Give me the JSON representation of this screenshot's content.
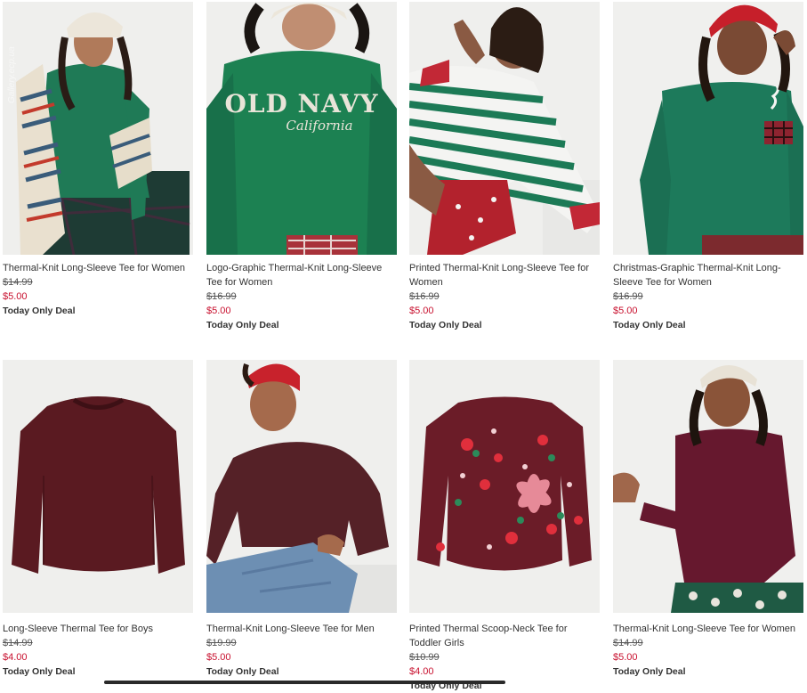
{
  "colors": {
    "sale": "#c8102e",
    "text": "#333333",
    "strike": "#555555"
  },
  "watermark": "Gallery.ecp.ua",
  "products": [
    {
      "image_icon": "woman-green-tee-fairisle-scarf-icon",
      "title": "Thermal-Knit Long-Sleeve Tee for Women",
      "original_price": "$14.99",
      "sale_price": "$5.00",
      "deal": "Today Only Deal"
    },
    {
      "image_icon": "woman-green-old-navy-logo-tee-icon",
      "title": "Logo-Graphic Thermal-Knit Long-Sleeve Tee for Women",
      "original_price": "$16.99",
      "sale_price": "$5.00",
      "deal": "Today Only Deal",
      "logo_text": "OLD NAVY",
      "logo_script": "California"
    },
    {
      "image_icon": "woman-green-white-striped-tee-icon",
      "title": "Printed Thermal-Knit Long-Sleeve Tee for Women",
      "original_price": "$16.99",
      "sale_price": "$5.00",
      "deal": "Today Only Deal"
    },
    {
      "image_icon": "woman-green-tee-plaid-pocket-icon",
      "title": "Christmas-Graphic Thermal-Knit Long-Sleeve Tee for Women",
      "original_price": "$16.99",
      "sale_price": "$5.00",
      "deal": "Today Only Deal"
    },
    {
      "image_icon": "burgundy-thermal-tee-flatlay-icon",
      "title": "Long-Sleeve Thermal Tee for Boys",
      "original_price": "$14.99",
      "sale_price": "$4.00",
      "deal": "Today Only Deal"
    },
    {
      "image_icon": "man-burgundy-thermal-tee-icon",
      "title": "Thermal-Knit Long-Sleeve Tee for Men",
      "original_price": "$19.99",
      "sale_price": "$5.00",
      "deal": "Today Only Deal"
    },
    {
      "image_icon": "floral-burgundy-toddler-tee-icon",
      "title": "Printed Thermal Scoop-Neck Tee for Toddler Girls",
      "original_price": "$10.99",
      "sale_price": "$4.00",
      "deal": "Today Only Deal"
    },
    {
      "image_icon": "woman-burgundy-thermal-tee-icon",
      "title": "Thermal-Knit Long-Sleeve Tee for Women",
      "original_price": "$14.99",
      "sale_price": "$5.00",
      "deal": "Today Only Deal"
    }
  ]
}
